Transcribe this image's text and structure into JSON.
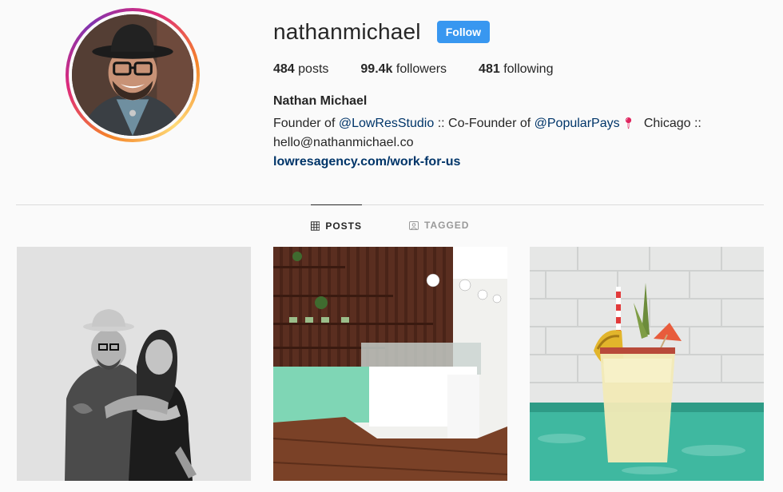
{
  "profile": {
    "username": "nathanmichael",
    "follow_label": "Follow",
    "stats": [
      {
        "value": "484",
        "label": "posts"
      },
      {
        "value": "99.4k",
        "label": "followers"
      },
      {
        "value": "481",
        "label": "following"
      }
    ],
    "full_name": "Nathan Michael",
    "bio": {
      "prefix": "Founder of ",
      "mention1": "@LowResStudio",
      "middle": " :: Co-Founder of ",
      "mention2": "@PopularPays",
      "location": " Chicago ::",
      "email": "hello@nathanmichael.co"
    },
    "website": "lowresagency.com/work-for-us"
  },
  "tabs": [
    {
      "label": "POSTS",
      "icon": "grid-icon",
      "active": true
    },
    {
      "label": "TAGGED",
      "icon": "tagged-icon",
      "active": false
    }
  ],
  "posts": [
    {
      "description_icon": "photo-couple"
    },
    {
      "description_icon": "photo-bakery-interior"
    },
    {
      "description_icon": "photo-pineapple-drink"
    }
  ],
  "colors": {
    "follow_button": "#3897f0",
    "link": "#003569",
    "text": "#262626",
    "muted": "#999999",
    "ring_start": "#f58529",
    "ring_end": "#dd2a7b"
  }
}
